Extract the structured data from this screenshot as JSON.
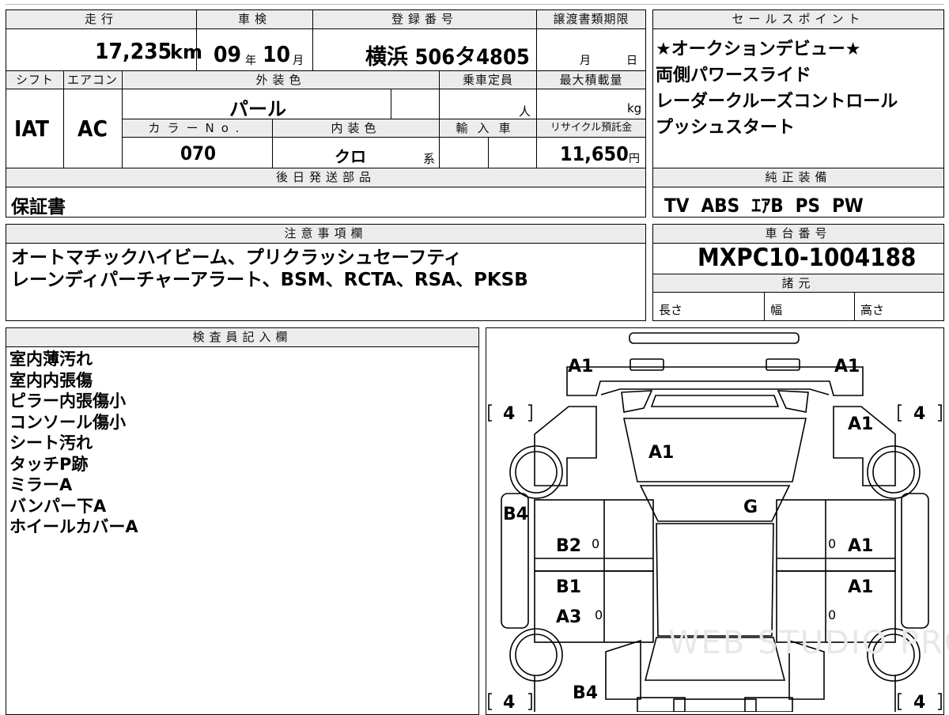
{
  "top": {
    "mileage_label": "走行",
    "mileage_value": "17,235",
    "mileage_unit": "km",
    "shaken_label": "車検",
    "shaken_year": "09",
    "shaken_year_unit": "年",
    "shaken_month": "10",
    "shaken_month_unit": "月",
    "reg_label": "登録番号",
    "reg_value": "横浜 506タ4805",
    "transfer_label": "譲渡書類期限",
    "transfer_month": "月",
    "transfer_day": "日"
  },
  "row2": {
    "shift_label": "シフト",
    "shift_value": "IAT",
    "aircon_label": "エアコン",
    "aircon_value": "AC",
    "exterior_label": "外装色",
    "exterior_value": "パール",
    "capacity_label": "乗車定員",
    "capacity_unit": "人",
    "maxload_label": "最大積載量",
    "maxload_unit": "kg",
    "colorno_label": "カラーNo.",
    "colorno_value": "070",
    "interior_label": "内装色",
    "interior_value": "クロ",
    "interior_unit": "系",
    "import_label": "輸入車",
    "recycle_label": "リサイクル預託金",
    "recycle_value": "11,650",
    "recycle_unit": "円"
  },
  "later": {
    "label": "後日発送部品",
    "value": "保証書"
  },
  "sales": {
    "label": "セールスポイント",
    "lines": [
      "★オークションデビュー★",
      "両側パワースライド",
      "レーダークルーズコントロール",
      "プッシュスタート"
    ]
  },
  "equip": {
    "label": "純正装備",
    "value": "TV  ABS  ｴｱB  PS  PW"
  },
  "notes": {
    "label": "注意事項欄",
    "lines": [
      "オートマチックハイビーム、プリクラッシュセーフティ",
      "レーンディパーチャーアラート、BSM、RCTA、RSA、PKSB"
    ]
  },
  "chassis": {
    "label": "車台番号",
    "value": "MXPC10-1004188",
    "specs_label": "諸元",
    "length_label": "長さ",
    "width_label": "幅",
    "height_label": "高さ"
  },
  "inspector": {
    "label": "検査員記入欄",
    "lines": [
      "室内薄汚れ",
      "室内内張傷",
      "ピラー内張傷小",
      "コンソール傷小",
      "シート汚れ",
      "タッチP跡",
      "ミラーA",
      "バンパー下A",
      "ホイールカバーA"
    ]
  },
  "diagram": {
    "marks": {
      "front_left": "A1",
      "front_right": "A1",
      "fender_right": "A1",
      "hood": "A1",
      "windshield": "G",
      "left_side_upper": "B4",
      "front_door_left": "B2",
      "front_door_right": "A1",
      "rear_door_left_1": "B1",
      "rear_door_left_2": "A3",
      "rear_door_right": "A1",
      "rear_bottom": "B4"
    },
    "tire_label": "4",
    "door_zero": "0",
    "watermark": "WEB STUDIO PRO"
  }
}
